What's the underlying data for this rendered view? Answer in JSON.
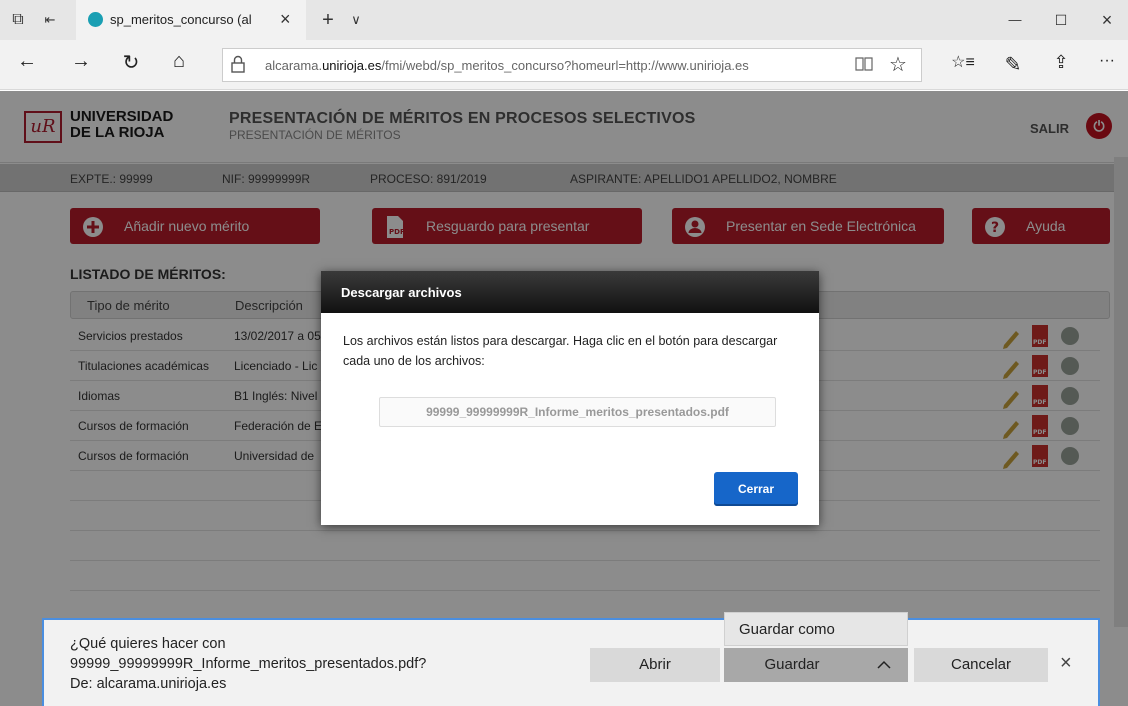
{
  "browser": {
    "tab_title": "sp_meritos_concurso (al",
    "url_prefix": "alcarama.",
    "url_domain": "unirioja.es",
    "url_path": "/fmi/webd/sp_meritos_concurso?homeurl=http://www.unirioja.es",
    "icons": {
      "back": "←",
      "forward": "→",
      "refresh": "↻",
      "home": "⌂",
      "lock": "🔒",
      "reading": "📖",
      "favorite": "☆",
      "favorites_hub": "☆≡",
      "pen": "✎",
      "share": "⇪",
      "more": "···",
      "new_tab": "+",
      "tab_menu": "∨",
      "tab_close": "×",
      "minimize": "—",
      "maximize": "☐",
      "close": "×"
    }
  },
  "header": {
    "uni_line1": "UNIVERSIDAD",
    "uni_line2": "DE LA RIOJA",
    "logo_text": "uR",
    "title": "PRESENTACIÓN DE MÉRITOS EN PROCESOS SELECTIVOS",
    "subtitle": "PRESENTACIÓN DE MÉRITOS",
    "salir": "SALIR"
  },
  "infobar": {
    "expte": "EXPTE.: 99999",
    "nif": "NIF: 99999999R",
    "proceso": "PROCESO: 891/2019",
    "aspirante": "ASPIRANTE: APELLIDO1 APELLIDO2, NOMBRE"
  },
  "actions": {
    "add": "Añadir nuevo mérito",
    "receipt": "Resguardo para presentar",
    "submit": "Presentar en Sede Electrónica",
    "help": "Ayuda"
  },
  "list": {
    "title": "LISTADO DE MÉRITOS:",
    "columns": [
      "Tipo de mérito",
      "Descripción"
    ],
    "rows": [
      {
        "tipo": "Servicios prestados",
        "desc": "13/02/2017 a 05"
      },
      {
        "tipo": "Titulaciones académicas",
        "desc": "Licenciado - Lic"
      },
      {
        "tipo": "Idiomas",
        "desc": "B1 Inglés: Nivel"
      },
      {
        "tipo": "Cursos de formación",
        "desc": "Federación de E"
      },
      {
        "tipo": "Cursos de formación",
        "desc": "Universidad de"
      }
    ]
  },
  "modal": {
    "title": "Descargar archivos",
    "message": "Los archivos están listos para descargar. Haga clic en el botón para descargar cada uno de los archivos:",
    "file": "99999_99999999R_Informe_meritos_presentados.pdf",
    "close": "Cerrar"
  },
  "download": {
    "line1": "¿Qué quieres hacer con",
    "line2": "99999_99999999R_Informe_meritos_presentados.pdf?",
    "line3": "De: alcarama.unirioja.es",
    "open": "Abrir",
    "save": "Guardar",
    "save_as": "Guardar como",
    "cancel": "Cancelar",
    "chevron": "^",
    "close_icon": "×"
  },
  "colors": {
    "accent_red": "#b81d2b",
    "primary_blue": "#1666c9",
    "dlbar_border": "#4a8ee0"
  }
}
